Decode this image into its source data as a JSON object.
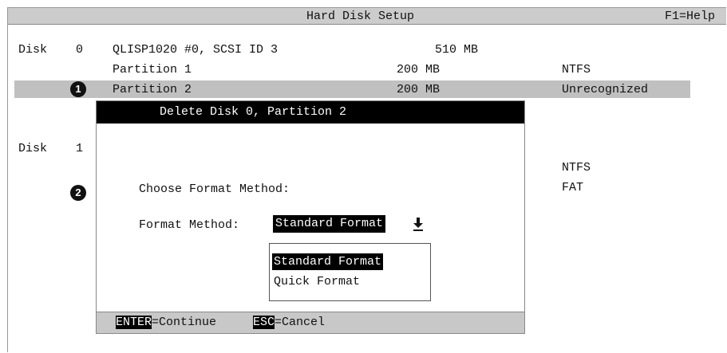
{
  "header": {
    "title": "Hard Disk Setup",
    "help": "F1=Help"
  },
  "disks": [
    {
      "label": "Disk",
      "number": "0",
      "name": "QLISP1020 #0, SCSI ID 3",
      "size": "510 MB",
      "partitions": [
        {
          "name": "Partition 1",
          "size": "200 MB",
          "fs": "NTFS"
        },
        {
          "name": "Partition 2",
          "size": "200 MB",
          "fs": "Unrecognized",
          "selected": true
        }
      ]
    },
    {
      "label": "Disk",
      "number": "1",
      "visible_fs": [
        "NTFS",
        "FAT"
      ]
    }
  ],
  "markers": [
    "1",
    "2"
  ],
  "dialog": {
    "title": "Delete Disk 0, Partition 2",
    "prompt": "Choose Format Method:",
    "field_label": "Format Method:",
    "selected_value": "Standard Format",
    "options": [
      "Standard Format",
      "Quick Format"
    ],
    "footer": {
      "enter_key": "ENTER",
      "enter_action": "=Continue",
      "esc_key": "ESC",
      "esc_action": "=Cancel"
    }
  }
}
